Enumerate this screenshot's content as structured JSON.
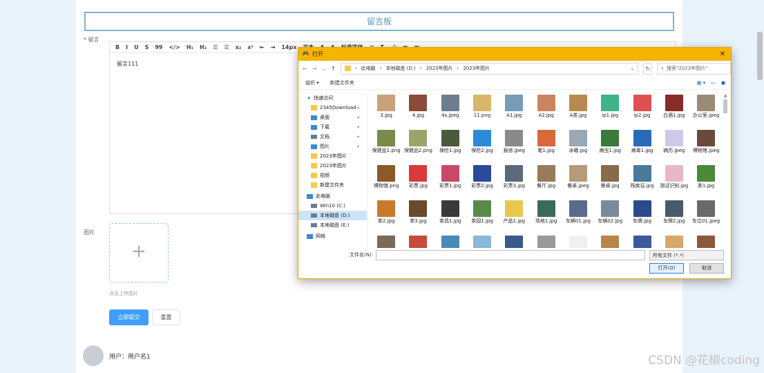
{
  "page": {
    "title": "留言板",
    "msg_label": "* 留言",
    "image_label": "图片",
    "upload_hint": "点击上传图片",
    "plus": "+",
    "submit": "立即提交",
    "reset": "重置",
    "user": "用户：用户名1",
    "editor_text": "留言111",
    "watermark": "CSDN @花椒coding"
  },
  "toolbar": [
    "B",
    "I",
    "U",
    "S",
    "99",
    "</>",
    "H₁",
    "H₂",
    "☰",
    "☰",
    "x₂",
    "x²",
    "⇤",
    "⇥",
    "14px",
    "文本",
    "A",
    "A̲",
    "标准字体",
    "≡",
    "Tₓ",
    "⚲",
    "▣",
    "▦"
  ],
  "dialog": {
    "title": "打开",
    "close": "✕",
    "breadcrumb": [
      "此电脑",
      "本地磁盘 (D:)",
      "2023年图片",
      "2023年图片"
    ],
    "search_placeholder": "搜索\"2023年图片\"",
    "organize": "组织 ▾",
    "new_folder": "新建文件夹",
    "nav": [
      {
        "label": "快速访问",
        "icon": "star",
        "type": "head"
      },
      {
        "label": "2345Download",
        "icon": "folder",
        "pin": true
      },
      {
        "label": "桌面",
        "icon": "desktop",
        "pin": true
      },
      {
        "label": "下载",
        "icon": "download",
        "pin": true
      },
      {
        "label": "文档",
        "icon": "doc",
        "pin": true
      },
      {
        "label": "图片",
        "icon": "pic",
        "pin": true
      },
      {
        "label": "2023年图片",
        "icon": "folder"
      },
      {
        "label": "2023年图片",
        "icon": "folder"
      },
      {
        "label": "视频",
        "icon": "folder"
      },
      {
        "label": "新建文件夹",
        "icon": "folder"
      },
      {
        "label": "此电脑",
        "icon": "pc",
        "type": "head"
      },
      {
        "label": "Win10 (C:)",
        "icon": "drive"
      },
      {
        "label": "本地磁盘 (D:)",
        "icon": "drive",
        "selected": true
      },
      {
        "label": "本地磁盘 (E:)",
        "icon": "drive"
      },
      {
        "label": "网络",
        "icon": "net",
        "type": "head"
      }
    ],
    "files": [
      {
        "n": "3.jpg",
        "c": "#c9a27a"
      },
      {
        "n": "4.jpg",
        "c": "#8b4a3a"
      },
      {
        "n": "4s.jpeg",
        "c": "#6c7d8e"
      },
      {
        "n": "11.png",
        "c": "#d8b66a"
      },
      {
        "n": "A1.jpg",
        "c": "#7a9bb8"
      },
      {
        "n": "A2.jpg",
        "c": "#c98560"
      },
      {
        "n": "A类.jpg",
        "c": "#b88a52"
      },
      {
        "n": "ip1.jpg",
        "c": "#3fb38a"
      },
      {
        "n": "ip2.jpg",
        "c": "#e05050"
      },
      {
        "n": "白酒1.jpg",
        "c": "#8a2b2b"
      },
      {
        "n": "办公室.jpeg",
        "c": "#9a8b76"
      },
      {
        "n": "保健品1.png",
        "c": "#7a8a4a"
      },
      {
        "n": "保健品2.png",
        "c": "#9aa56a"
      },
      {
        "n": "保险1.jpg",
        "c": "#4a5a3a"
      },
      {
        "n": "保险2.jpg",
        "c": "#2d8ad8"
      },
      {
        "n": "报修.jpeg",
        "c": "#8a8a8a"
      },
      {
        "n": "笔1.jpg",
        "c": "#d86a3a"
      },
      {
        "n": "冰箱.jpg",
        "c": "#9aa8b5"
      },
      {
        "n": "病虫1.jpg",
        "c": "#3a7a3a"
      },
      {
        "n": "病毒1.jpg",
        "c": "#2a6ab8"
      },
      {
        "n": "病历.jpeg",
        "c": "#cfc8e8"
      },
      {
        "n": "博物馆.jpeg",
        "c": "#6a4a3a"
      },
      {
        "n": "博物馆.png",
        "c": "#8a5a2a"
      },
      {
        "n": "彩票.jpg",
        "c": "#d83a3a"
      },
      {
        "n": "彩票1.jpg",
        "c": "#c84a6a"
      },
      {
        "n": "彩票2.jpg",
        "c": "#2a4a9a"
      },
      {
        "n": "彩票3.jpg",
        "c": "#5a6a7a"
      },
      {
        "n": "餐厅.jpg",
        "c": "#9a7a5a"
      },
      {
        "n": "餐桌.jpeg",
        "c": "#b89a7a"
      },
      {
        "n": "餐桌.jpg",
        "c": "#8a6a4a"
      },
      {
        "n": "残疾证.jpg",
        "c": "#4a7a9a"
      },
      {
        "n": "测试识别.jpg",
        "c": "#e8b8c8"
      },
      {
        "n": "茶1.jpg",
        "c": "#4a8a3a"
      },
      {
        "n": "茶2.jpg",
        "c": "#c87a2a"
      },
      {
        "n": "茶3.jpg",
        "c": "#6a4a2a"
      },
      {
        "n": "茶具1.jpg",
        "c": "#3a3a3a"
      },
      {
        "n": "茶园1.jpg",
        "c": "#5a8a4a"
      },
      {
        "n": "产品1.jpg",
        "c": "#e8c84a"
      },
      {
        "n": "场地1.jpg",
        "c": "#3a6a5a"
      },
      {
        "n": "车辆01.jpg",
        "c": "#5a6a8a"
      },
      {
        "n": "车辆02.jpg",
        "c": "#7a8a9a"
      },
      {
        "n": "车牌.jpg",
        "c": "#2a4a8a"
      },
      {
        "n": "车牌2.jpg",
        "c": "#4a5a6a"
      },
      {
        "n": "车位01.jpeg",
        "c": "#6a6a6a"
      },
      {
        "n": "",
        "c": "#7a6a5a"
      },
      {
        "n": "",
        "c": "#c84a3a"
      },
      {
        "n": "",
        "c": "#4a8ab8"
      },
      {
        "n": "",
        "c": "#8ab8d8"
      },
      {
        "n": "",
        "c": "#3a5a8a"
      },
      {
        "n": "",
        "c": "#9a9a9a"
      },
      {
        "n": "",
        "c": "#f0f0f0"
      },
      {
        "n": "",
        "c": "#b8864a"
      },
      {
        "n": "",
        "c": "#3a5a9a"
      },
      {
        "n": "",
        "c": "#d8a86a"
      },
      {
        "n": "",
        "c": "#8a5a3a"
      }
    ],
    "filename_label": "文件名(N):",
    "filetype": "所有文件 (*.*)",
    "open": "打开(O)",
    "cancel": "取消"
  }
}
